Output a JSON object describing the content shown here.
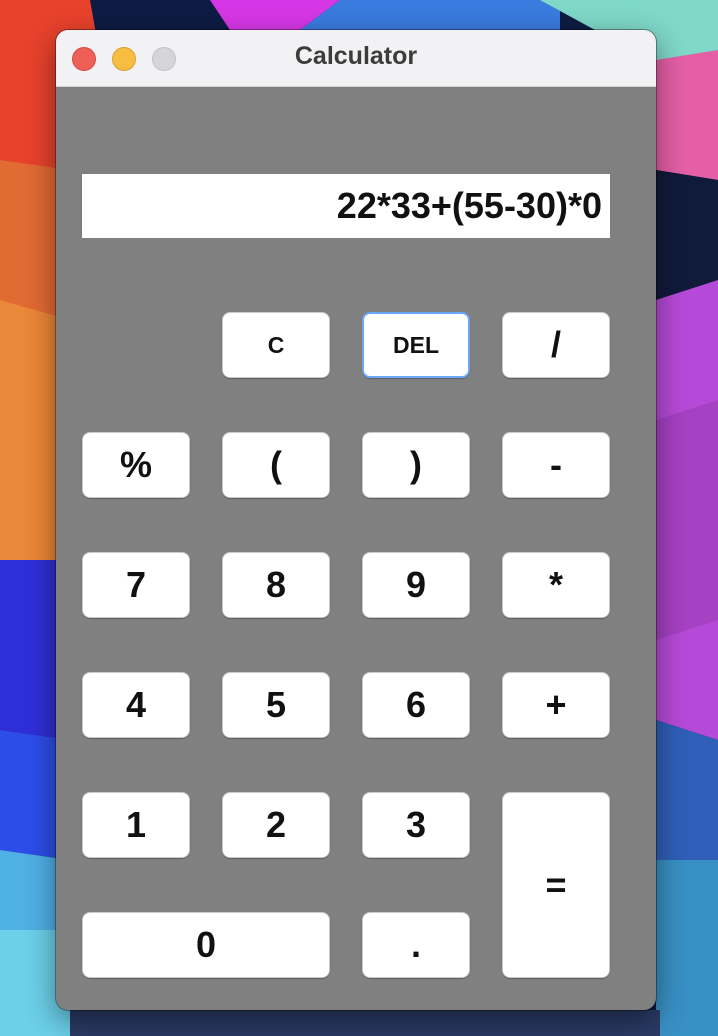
{
  "window": {
    "title": "Calculator",
    "controls": [
      "close",
      "minimize",
      "zoom"
    ]
  },
  "display": {
    "expression": "22*33+(55-30)*0"
  },
  "keys": {
    "clear": "C",
    "delete": "DEL",
    "divide": "/",
    "percent": "%",
    "open_paren": "(",
    "close_paren": ")",
    "minus": "-",
    "seven": "7",
    "eight": "8",
    "nine": "9",
    "multiply": "*",
    "four": "4",
    "five": "5",
    "six": "6",
    "plus": "+",
    "one": "1",
    "two": "2",
    "three": "3",
    "equals": "=",
    "zero": "0",
    "decimal": "."
  },
  "colors": {
    "window_body": "#808080",
    "titlebar": "#f2f1f4",
    "key_background": "#ffffff",
    "focus_ring": "#6aa7f5",
    "close": "#ee5f57",
    "minimize": "#f6bd41",
    "zoom_disabled": "#d6d5d8"
  }
}
